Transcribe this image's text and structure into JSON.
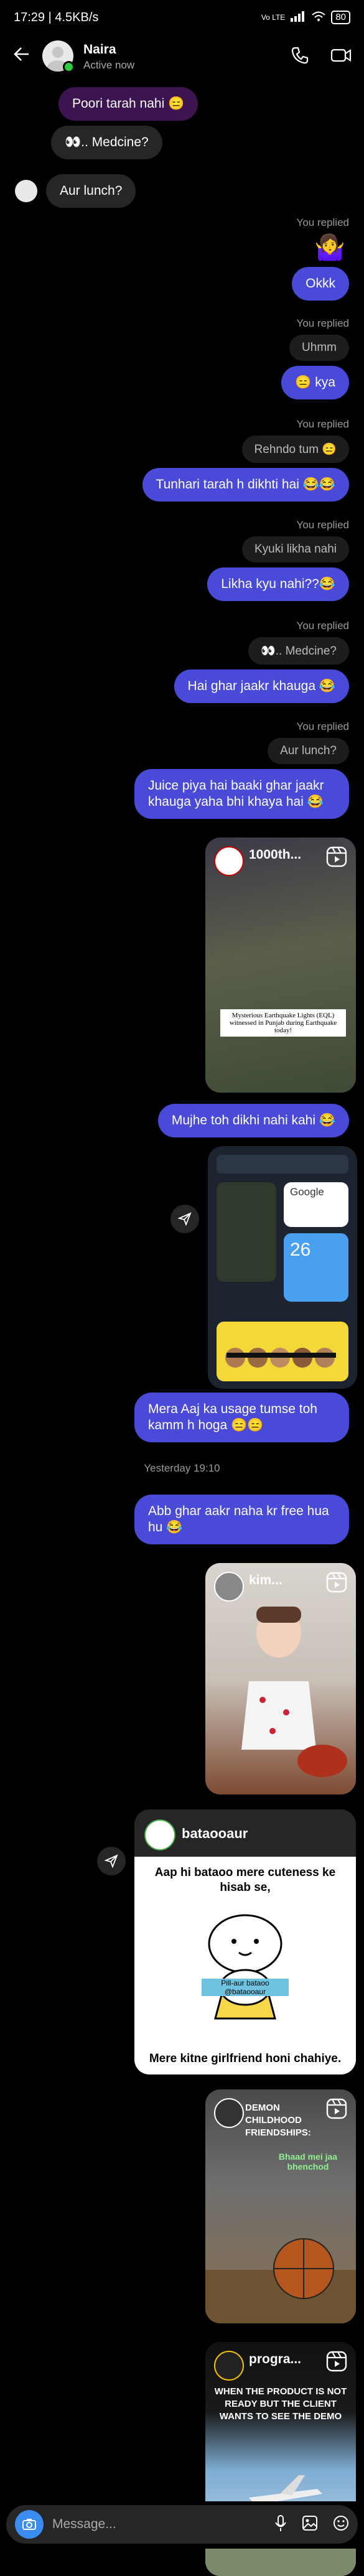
{
  "status": {
    "time": "17:29 | 4.5KB/s",
    "network": "Vo LTE",
    "battery": "80"
  },
  "contact": {
    "name": "Naira",
    "status": "Active now"
  },
  "colors": {
    "outgoing": "#4a4ad8",
    "incoming": "#262626",
    "online": "#2ecc40"
  },
  "messages": {
    "m1": "Poori tarah nahi 😑",
    "m2": "👀.. Medcine?",
    "m3": "Aur lunch?",
    "replied": "You replied",
    "r1_out": "Okkk",
    "r2_quote": "Uhmm",
    "r2_out": "😑 kya",
    "r3_quote": "Rehndo tum 😑",
    "r3_out": "Tunhari tarah h dikhti hai 😂😂",
    "r4_quote": "Kyuki likha nahi",
    "r4_out": "Likha kyu nahi??😂",
    "r5_quote": "👀.. Medcine?",
    "r5_out": "Hai ghar jaakr khauga 😂",
    "r6_quote": "Aur lunch?",
    "r6_out": "Juice piya hai baaki ghar jaakr khauga yaha bhi khaya hai 😂",
    "after_reel": "Mujhe toh dikhi nahi kahi 😂",
    "after_ss": "Mera Aaj ka usage tumse toh kamm h hoga 😑😑",
    "timestamp": "Yesterday 19:10",
    "after_ts": "Abb ghar aakr naha kr free hua hu 😂"
  },
  "reel1": {
    "title": "1000th...",
    "caption": "Mysterious Earthquake Lights (EQL) witnessed in Punjab during Earthquake today!"
  },
  "screenshot": {
    "temp": "26",
    "search_label": "Google"
  },
  "reel2": {
    "title": "kim..."
  },
  "post": {
    "account": "bataooaur",
    "line1": "Aap hi bataoo mere cuteness ke hisab se,",
    "sign": "Pill-aur bataoo @bataooaur",
    "line2": "Mere kitne girlfriend honi chahiye."
  },
  "reel3": {
    "title": "DEMON CHILDHOOD FRIENDSHIPS:",
    "caption": "Bhaad mei jaa bhenchod"
  },
  "reel4": {
    "title": "progra...",
    "caption": "WHEN THE PRODUCT IS NOT READY BUT THE CLIENT WANTS TO SEE THE DEMO"
  },
  "composer": {
    "placeholder": "Message..."
  }
}
